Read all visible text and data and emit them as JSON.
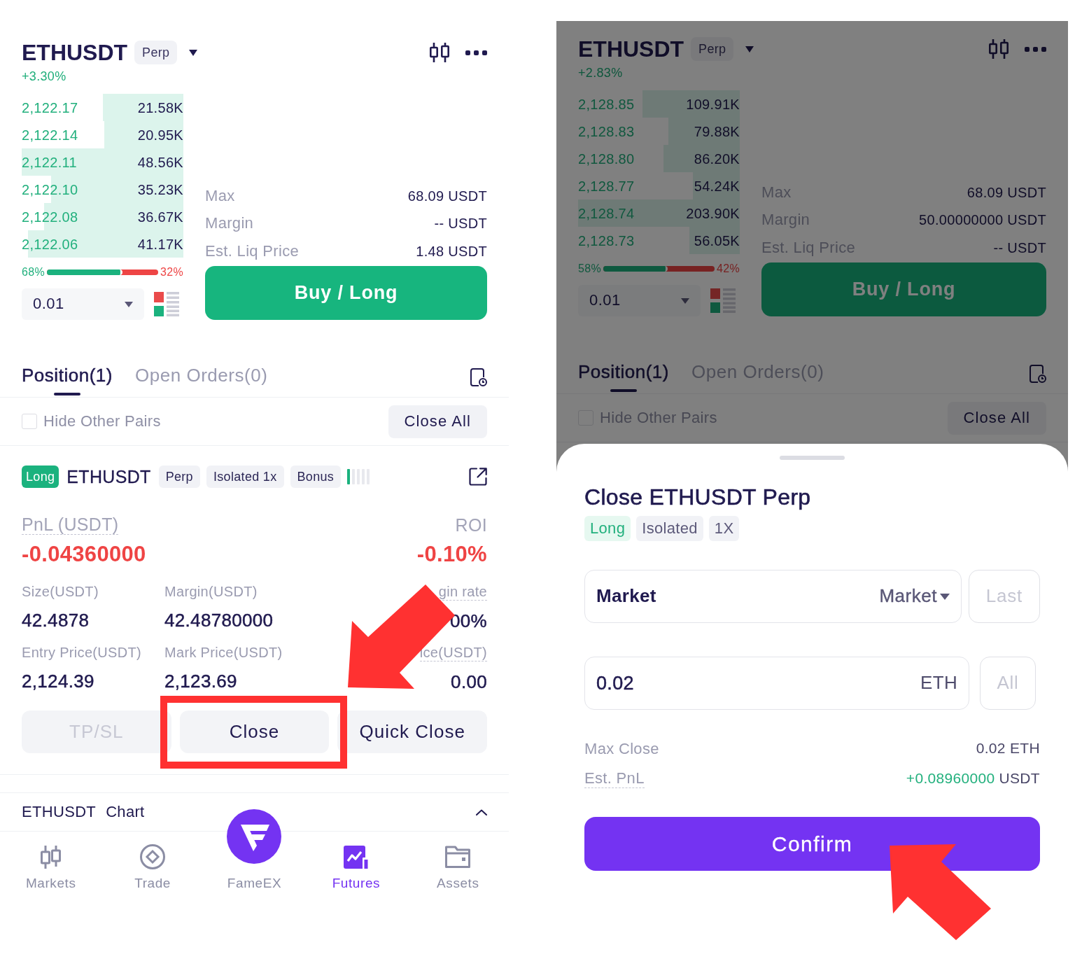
{
  "screens": [
    {
      "dimmed": false,
      "header": {
        "symbol": "ETHUSDT",
        "contract": "Perp",
        "change": "+3.30%"
      },
      "order_book": {
        "rows": [
          {
            "price": "2,122.17",
            "amount": "21.58K",
            "level": 0.5
          },
          {
            "price": "2,122.14",
            "amount": "20.95K",
            "level": 0.49
          },
          {
            "price": "2,122.11",
            "amount": "48.56K",
            "level": 1
          },
          {
            "price": "2,122.10",
            "amount": "35.23K",
            "level": 0.82
          },
          {
            "price": "2,122.08",
            "amount": "36.67K",
            "level": 0.86
          },
          {
            "price": "2,122.06",
            "amount": "41.17K",
            "level": 0.96
          }
        ],
        "ratio": {
          "buy": "68%",
          "sell": "32%",
          "level": 0.68
        },
        "precision": "0.01"
      },
      "order_form": {
        "rows": [
          {
            "label": "Max",
            "value": "68.09 USDT"
          },
          {
            "label": "Margin",
            "value": "-- USDT"
          },
          {
            "label": "Est. Liq Price",
            "value": "1.48 USDT"
          }
        ],
        "submit": "Buy / Long"
      },
      "tabs": [
        {
          "label": "Position(1)",
          "selected": true
        },
        {
          "label": "Open Orders(0)",
          "selected": false
        }
      ],
      "filter": {
        "label": "Hide Other Pairs",
        "checked": false
      },
      "close_all": "Close All",
      "position": {
        "side": "Long",
        "symbol": "ETHUSDT",
        "tags": [
          "Perp",
          "Isolated 1x",
          "Bonus"
        ],
        "pnl": {
          "label": "PnL (USDT)",
          "value": "-0.04360000",
          "tooltip": true,
          "negative": true
        },
        "roi": {
          "label": "ROI",
          "value": "-0.10%",
          "tooltip": false,
          "negative": true
        },
        "stats": [
          {
            "label": "Size(USDT)",
            "value": "42.4878",
            "tooltip": false
          },
          {
            "label": "Margin(USDT)",
            "value": "42.48780000",
            "tooltip": false
          },
          {
            "label": "gin rate",
            "value": "00%",
            "tooltip": true
          },
          {
            "label": "Entry Price(USDT)",
            "value": "2,124.39",
            "tooltip": false
          },
          {
            "label": "Mark Price(USDT)",
            "value": "2,123.69",
            "tooltip": false
          },
          {
            "label": "ice(USDT)",
            "value": "0.00",
            "tooltip": true
          }
        ],
        "actions": [
          {
            "label": "TP/SL",
            "disabled": true,
            "highlighted": false
          },
          {
            "label": "Close",
            "disabled": false,
            "highlighted": true
          },
          {
            "label": "Quick Close",
            "disabled": false,
            "highlighted": false
          }
        ]
      },
      "chart_bar": {
        "symbol": "ETHUSDT",
        "label": "Chart"
      },
      "bottom_nav": [
        {
          "label": "Markets",
          "kind": "tab",
          "selected": false
        },
        {
          "label": "Trade",
          "kind": "tab",
          "selected": false
        },
        {
          "label": "FameEX",
          "kind": "logo",
          "selected": false
        },
        {
          "label": "Futures",
          "kind": "tab",
          "selected": true
        },
        {
          "label": "Assets",
          "kind": "tab",
          "selected": false
        }
      ]
    },
    {
      "dimmed": true,
      "header": {
        "symbol": "ETHUSDT",
        "contract": "Perp",
        "change": "+2.83%"
      },
      "order_book": {
        "rows": [
          {
            "price": "2,128.85",
            "amount": "109.91K",
            "level": 0.6
          },
          {
            "price": "2,128.83",
            "amount": "79.88K",
            "level": 0.44
          },
          {
            "price": "2,128.80",
            "amount": "86.20K",
            "level": 0.47
          },
          {
            "price": "2,128.77",
            "amount": "54.24K",
            "level": 0.29
          },
          {
            "price": "2,128.74",
            "amount": "203.90K",
            "level": 1
          },
          {
            "price": "2,128.73",
            "amount": "56.05K",
            "level": 0.31
          }
        ],
        "ratio": {
          "buy": "58%",
          "sell": "42%",
          "level": 0.58
        },
        "precision": "0.01"
      },
      "order_form": {
        "rows": [
          {
            "label": "Max",
            "value": "68.09 USDT"
          },
          {
            "label": "Margin",
            "value": "50.00000000 USDT"
          },
          {
            "label": "Est. Liq Price",
            "value": "-- USDT"
          }
        ],
        "submit": "Buy / Long"
      },
      "tabs": [
        {
          "label": "Position(1)",
          "selected": true
        },
        {
          "label": "Open Orders(0)",
          "selected": false
        }
      ],
      "filter": {
        "label": "Hide Other Pairs",
        "checked": false
      },
      "close_all": "Close All",
      "sheet": {
        "title": "Close ETHUSDT Perp",
        "tags": [
          {
            "label": "Long",
            "kind": "side"
          },
          {
            "label": "Isolated",
            "kind": "plain"
          },
          {
            "label": "1X",
            "kind": "plain"
          }
        ],
        "price_field": {
          "value": "Market",
          "order_type": "Market",
          "side_button": "Last"
        },
        "amount_field": {
          "value": "0.02",
          "unit": "ETH",
          "side_button": "All"
        },
        "info": [
          {
            "label": "Max Close",
            "value": "0.02 ETH",
            "positive": false,
            "tooltip": false
          },
          {
            "label": "Est. PnL",
            "value": "+0.08960000",
            "unit": "USDT",
            "positive": true,
            "tooltip": true
          }
        ],
        "confirm": {
          "label": "Confirm",
          "highlighted": true
        }
      }
    }
  ]
}
